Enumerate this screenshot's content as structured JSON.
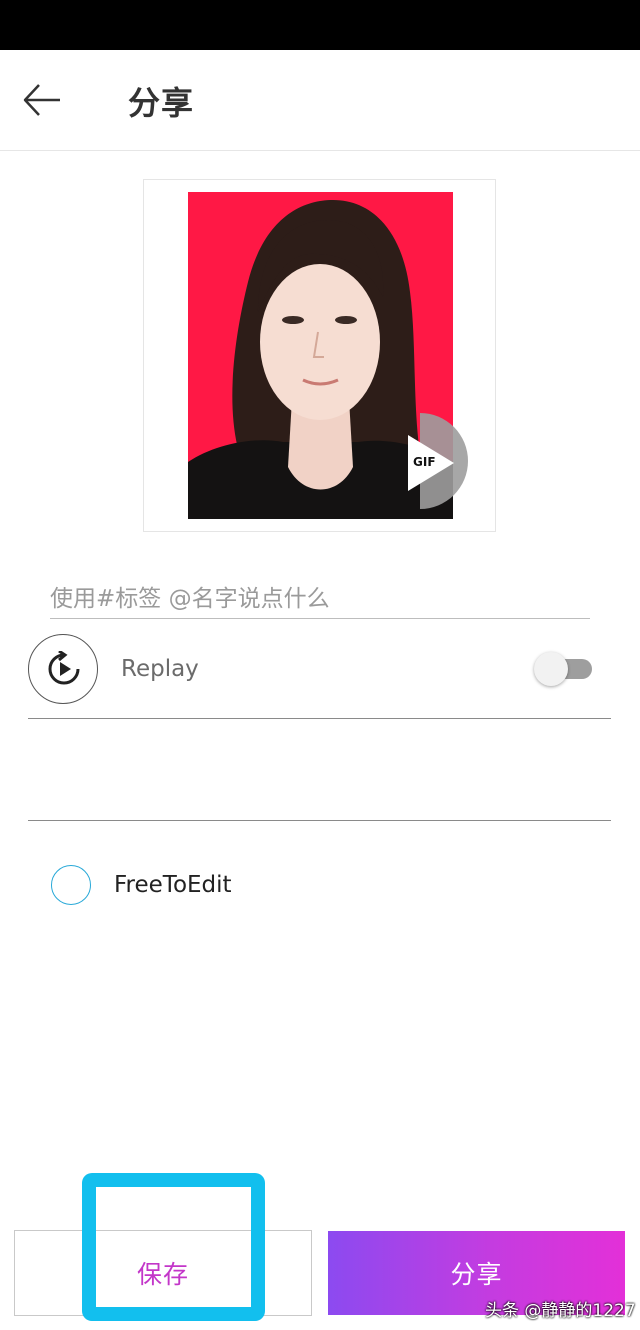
{
  "header": {
    "title": "分享"
  },
  "preview": {
    "badge": "GIF"
  },
  "caption": {
    "placeholder": "使用#标签 @名字说点什么",
    "value": ""
  },
  "replay": {
    "label": "Replay",
    "enabled": false
  },
  "license": {
    "label": "FreeToEdit",
    "checked": false
  },
  "actions": {
    "save_label": "保存",
    "share_label": "分享"
  },
  "watermark": {
    "text": "头条 @静静的1227"
  },
  "colors": {
    "photo_background": "#ff1845",
    "accent_purple": "#c336c9",
    "share_gradient_start": "#8c4af0",
    "share_gradient_end": "#e330d8",
    "highlight": "#12bfee",
    "radio_border": "#29a9d8"
  },
  "icons": {
    "back": "arrow-left-icon",
    "replay": "replay-icon",
    "gif_play": "gif-play-icon",
    "radio": "radio-unchecked-icon"
  }
}
